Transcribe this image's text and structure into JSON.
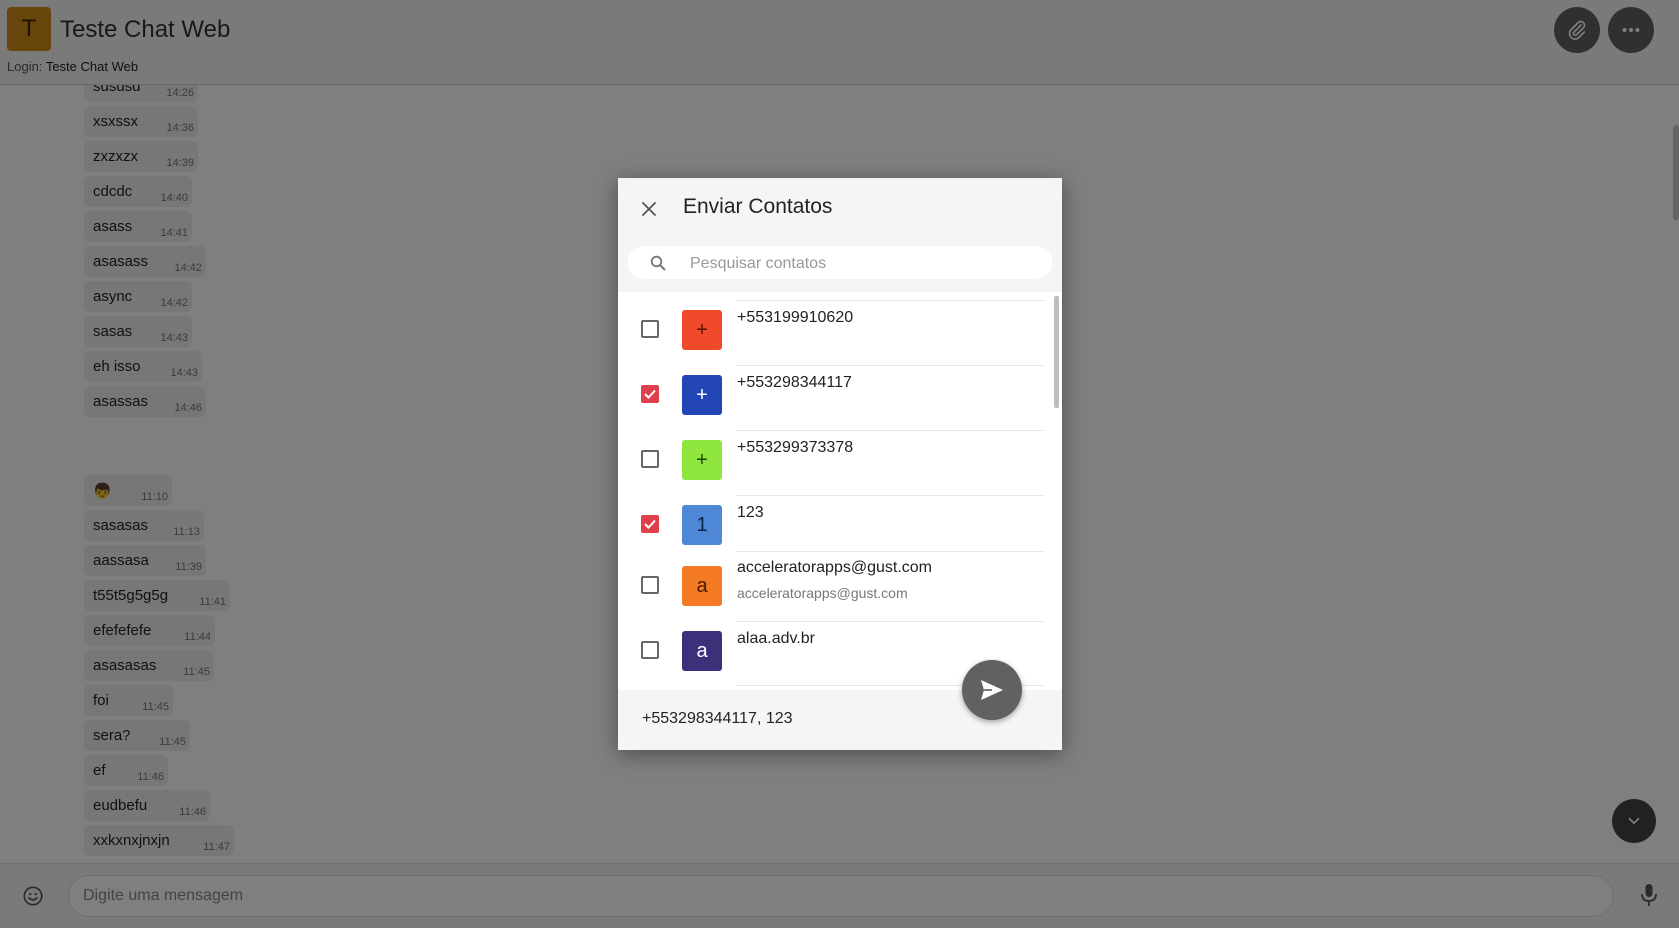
{
  "header": {
    "avatar_letter": "T",
    "title": "Teste Chat Web",
    "login_label": "Login:",
    "login_value": "Teste Chat Web"
  },
  "chat": {
    "messages": [
      {
        "text": "sdsdsd",
        "time": "14:26"
      },
      {
        "text": "xsxssx",
        "time": "14:36"
      },
      {
        "text": "zxzxzx",
        "time": "14:39"
      },
      {
        "text": "cdcdc",
        "time": "14:40"
      },
      {
        "text": "asass",
        "time": "14:41"
      },
      {
        "text": "asasass",
        "time": "14:42"
      },
      {
        "text": "async",
        "time": "14:42"
      },
      {
        "text": "sasas",
        "time": "14:43"
      },
      {
        "text": "eh isso",
        "time": "14:43"
      },
      {
        "text": "asassas",
        "time": "14:46"
      },
      {
        "text": "👦",
        "time": "11:10"
      },
      {
        "text": "sasasas",
        "time": "11:13"
      },
      {
        "text": "aassasa",
        "time": "11:39"
      },
      {
        "text": "t55t5g5g5g",
        "time": "11:41"
      },
      {
        "text": "efefefefe",
        "time": "11:44"
      },
      {
        "text": "asasasas",
        "time": "11:45"
      },
      {
        "text": "foi",
        "time": "11:45"
      },
      {
        "text": "sera?",
        "time": "11:45"
      },
      {
        "text": "ef",
        "time": "11:46"
      },
      {
        "text": "eudbefu",
        "time": "11:46"
      },
      {
        "text": "xxkxnxjnxjn",
        "time": "11:47"
      }
    ]
  },
  "input": {
    "placeholder": "Digite uma mensagem"
  },
  "dialog": {
    "title": "Enviar Contatos",
    "search_placeholder": "Pesquisar contatos",
    "contacts": [
      {
        "initial": "+",
        "name": "+553199910620",
        "subtitle": "",
        "checked": false,
        "color": "#f0492b",
        "text_color": "#5a0f00"
      },
      {
        "initial": "+",
        "name": "+553298344117",
        "subtitle": "",
        "checked": true,
        "color": "#2346b6",
        "text_color": "#ffffff"
      },
      {
        "initial": "+",
        "name": "+553299373378",
        "subtitle": "",
        "checked": false,
        "color": "#8ee63f",
        "text_color": "#1f4400"
      },
      {
        "initial": "1",
        "name": "123",
        "subtitle": "",
        "checked": true,
        "color": "#4e87d6",
        "text_color": "#0b2448"
      },
      {
        "initial": "a",
        "name": "acceleratorapps@gust.com",
        "subtitle": "acceleratorapps@gust.com",
        "checked": false,
        "color": "#f47a23",
        "text_color": "#4a1b00"
      },
      {
        "initial": "a",
        "name": "alaa.adv.br",
        "subtitle": "",
        "checked": false,
        "color": "#3d2f7a",
        "text_color": "#ffffff"
      }
    ],
    "selected_summary": "+553298344117, 123"
  },
  "colors": {
    "checkbox_checked": "#e0404e",
    "header_button": "#616161"
  },
  "icons": {
    "attach": "paperclip-icon",
    "more": "more-horizontal-icon",
    "close": "close-icon",
    "search": "search-icon",
    "send": "send-icon",
    "emoji": "emoji-icon",
    "mic": "microphone-icon",
    "scroll_down": "chevron-down-icon"
  }
}
